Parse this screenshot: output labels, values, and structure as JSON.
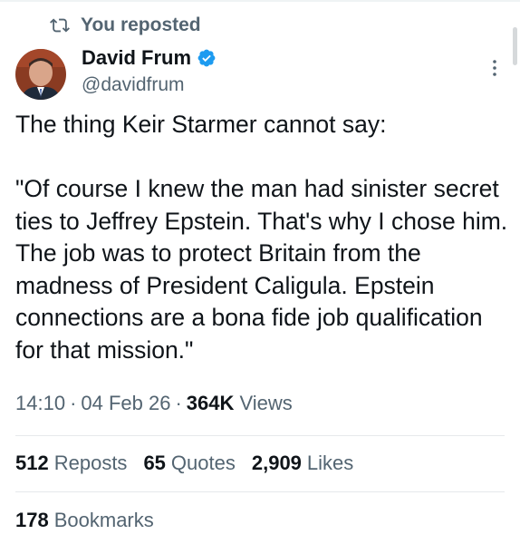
{
  "repost_header": {
    "label": "You reposted",
    "icon": "repost-icon"
  },
  "author": {
    "name": "David Frum",
    "handle": "@davidfrum",
    "verified": true,
    "verified_color": "#1d9bf0"
  },
  "tweet": {
    "text_intro": "The thing Keir Starmer cannot say:",
    "text_quote": "\"Of course I knew the man had sinister secret ties to Jeffrey Epstein. That's why I chose him. The job was to protect Britain from the madness of President Caligula. Epstein connections are a bona fide job qualification for that mission.\""
  },
  "meta": {
    "time": "14:10",
    "date": "04 Feb 26",
    "separator": "·",
    "views_count": "364K",
    "views_label": "Views"
  },
  "stats": {
    "reposts_count": "512",
    "reposts_label": "Reposts",
    "quotes_count": "65",
    "quotes_label": "Quotes",
    "likes_count": "2,909",
    "likes_label": "Likes",
    "bookmarks_count": "178",
    "bookmarks_label": "Bookmarks"
  },
  "colors": {
    "text_primary": "#0f1419",
    "text_secondary": "#536471",
    "divider": "#e6e9eb"
  }
}
